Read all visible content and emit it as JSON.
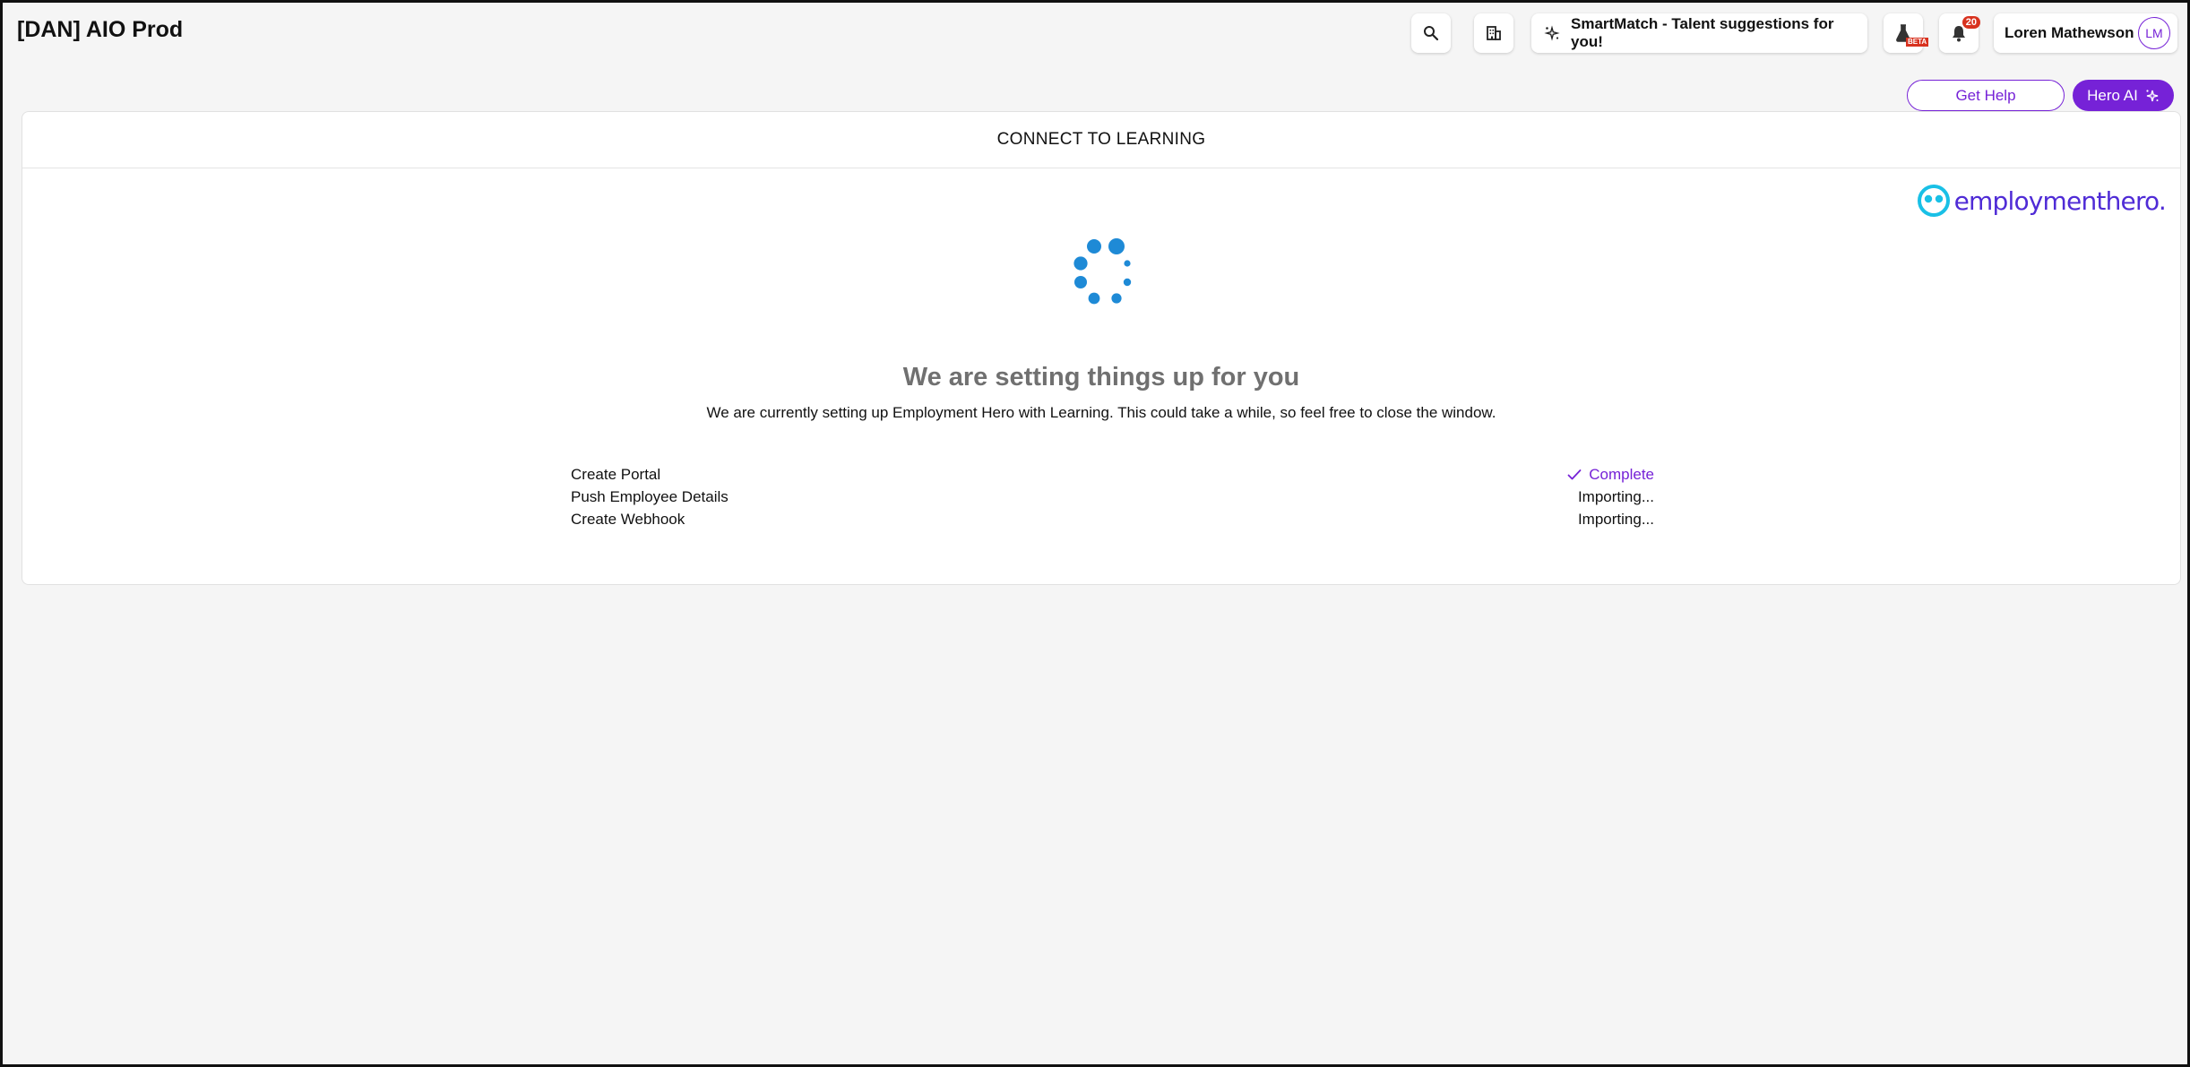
{
  "header": {
    "org_title": "[DAN] AIO Prod",
    "smartmatch_label": "SmartMatch - Talent suggestions for you!",
    "beta_label": "BETA",
    "notification_count": "20",
    "user_name": "Loren Mathewson",
    "user_initials": "LM"
  },
  "actions": {
    "get_help_label": "Get Help",
    "hero_ai_label": "Hero AI"
  },
  "card": {
    "title": "CONNECT TO LEARNING",
    "brand": "employmenthero.",
    "heading": "We are setting things up for you",
    "description": "We are currently setting up Employment Hero with Learning. This could take a while, so feel free to close the window.",
    "steps": [
      {
        "label": "Create Portal",
        "status": "Complete"
      },
      {
        "label": "Push Employee Details",
        "status": "Importing..."
      },
      {
        "label": "Create Webhook",
        "status": "Importing..."
      }
    ]
  },
  "colors": {
    "accent": "#7622d7",
    "spinner": "#1e8ad6",
    "logo_icon": "#19c0e6",
    "logo_text": "#4f2bd6",
    "badge": "#d8321f"
  },
  "icons": [
    "search-icon",
    "building-icon",
    "sparkle-icon",
    "flask-icon",
    "bell-icon",
    "check-icon"
  ]
}
